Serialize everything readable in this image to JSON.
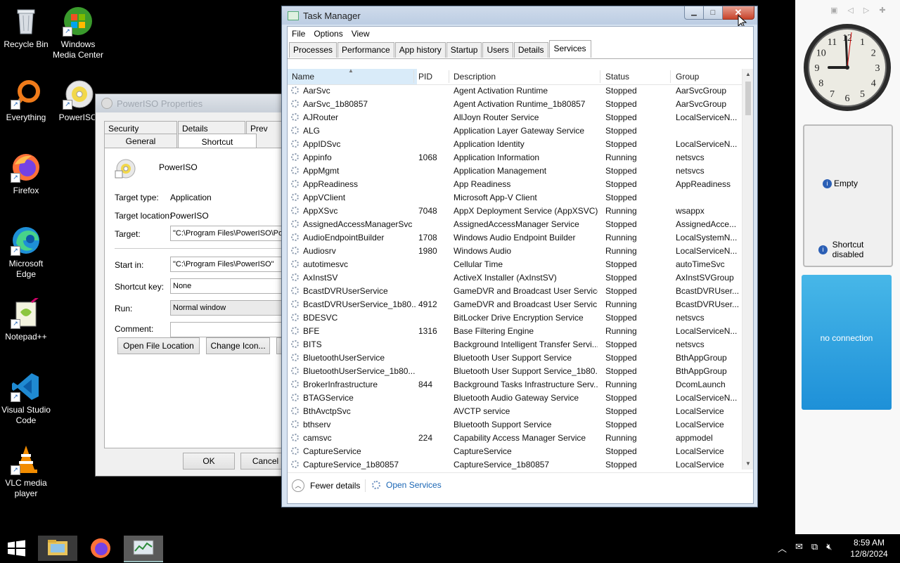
{
  "desktop": {
    "icons": [
      {
        "label": "Recycle Bin",
        "icon": "recycle-bin-icon"
      },
      {
        "label": "Windows Media Center",
        "icon": "media-center-icon"
      },
      {
        "label": "Everything",
        "icon": "everything-icon"
      },
      {
        "label": "PowerISO",
        "icon": "poweriso-icon"
      },
      {
        "label": "Firefox",
        "icon": "firefox-icon"
      },
      {
        "label": "Microsoft Edge",
        "icon": "edge-icon"
      },
      {
        "label": "Notepad++",
        "icon": "notepadpp-icon"
      },
      {
        "label": "Visual Studio Code",
        "icon": "vscode-icon"
      },
      {
        "label": "VLC media player",
        "icon": "vlc-icon"
      }
    ]
  },
  "properties": {
    "title": "PowerISO Properties",
    "tabs_top": [
      "Security",
      "Details",
      "Prev"
    ],
    "tabs_bottom": [
      "General",
      "Shortcut"
    ],
    "app_name": "PowerISO",
    "target_type_label": "Target type:",
    "target_type": "Application",
    "target_location_label": "Target location:",
    "target_location": "PowerISO",
    "target_label": "Target:",
    "target": "\"C:\\Program Files\\PowerISO\\PowerISO.exe\"",
    "start_in_label": "Start in:",
    "start_in": "\"C:\\Program Files\\PowerISO\"",
    "shortcut_key_label": "Shortcut key:",
    "shortcut_key": "None",
    "run_label": "Run:",
    "run": "Normal window",
    "comment_label": "Comment:",
    "comment": "",
    "open_location": "Open File Location",
    "change_icon": "Change Icon...",
    "ok": "OK",
    "cancel": "Cancel"
  },
  "taskmgr": {
    "title": "Task Manager",
    "menu": [
      "File",
      "Options",
      "View"
    ],
    "tabs": [
      "Processes",
      "Performance",
      "App history",
      "Startup",
      "Users",
      "Details",
      "Services"
    ],
    "active_tab": "Services",
    "columns": {
      "name": "Name",
      "pid": "PID",
      "description": "Description",
      "status": "Status",
      "group": "Group"
    },
    "rows": [
      {
        "name": "AarSvc",
        "pid": "",
        "desc": "Agent Activation Runtime",
        "status": "Stopped",
        "group": "AarSvcGroup"
      },
      {
        "name": "AarSvc_1b80857",
        "pid": "",
        "desc": "Agent Activation Runtime_1b80857",
        "status": "Stopped",
        "group": "AarSvcGroup"
      },
      {
        "name": "AJRouter",
        "pid": "",
        "desc": "AllJoyn Router Service",
        "status": "Stopped",
        "group": "LocalServiceN..."
      },
      {
        "name": "ALG",
        "pid": "",
        "desc": "Application Layer Gateway Service",
        "status": "Stopped",
        "group": ""
      },
      {
        "name": "AppIDSvc",
        "pid": "",
        "desc": "Application Identity",
        "status": "Stopped",
        "group": "LocalServiceN..."
      },
      {
        "name": "Appinfo",
        "pid": "1068",
        "desc": "Application Information",
        "status": "Running",
        "group": "netsvcs"
      },
      {
        "name": "AppMgmt",
        "pid": "",
        "desc": "Application Management",
        "status": "Stopped",
        "group": "netsvcs"
      },
      {
        "name": "AppReadiness",
        "pid": "",
        "desc": "App Readiness",
        "status": "Stopped",
        "group": "AppReadiness"
      },
      {
        "name": "AppVClient",
        "pid": "",
        "desc": "Microsoft App-V Client",
        "status": "Stopped",
        "group": ""
      },
      {
        "name": "AppXSvc",
        "pid": "7048",
        "desc": "AppX Deployment Service (AppXSVC)",
        "status": "Running",
        "group": "wsappx"
      },
      {
        "name": "AssignedAccessManagerSvc",
        "pid": "",
        "desc": "AssignedAccessManager Service",
        "status": "Stopped",
        "group": "AssignedAcce..."
      },
      {
        "name": "AudioEndpointBuilder",
        "pid": "1708",
        "desc": "Windows Audio Endpoint Builder",
        "status": "Running",
        "group": "LocalSystemN..."
      },
      {
        "name": "Audiosrv",
        "pid": "1980",
        "desc": "Windows Audio",
        "status": "Running",
        "group": "LocalServiceN..."
      },
      {
        "name": "autotimesvc",
        "pid": "",
        "desc": "Cellular Time",
        "status": "Stopped",
        "group": "autoTimeSvc"
      },
      {
        "name": "AxInstSV",
        "pid": "",
        "desc": "ActiveX Installer (AxInstSV)",
        "status": "Stopped",
        "group": "AxInstSVGroup"
      },
      {
        "name": "BcastDVRUserService",
        "pid": "",
        "desc": "GameDVR and Broadcast User Service",
        "status": "Stopped",
        "group": "BcastDVRUser..."
      },
      {
        "name": "BcastDVRUserService_1b80...",
        "pid": "4912",
        "desc": "GameDVR and Broadcast User Servic...",
        "status": "Running",
        "group": "BcastDVRUser..."
      },
      {
        "name": "BDESVC",
        "pid": "",
        "desc": "BitLocker Drive Encryption Service",
        "status": "Stopped",
        "group": "netsvcs"
      },
      {
        "name": "BFE",
        "pid": "1316",
        "desc": "Base Filtering Engine",
        "status": "Running",
        "group": "LocalServiceN..."
      },
      {
        "name": "BITS",
        "pid": "",
        "desc": "Background Intelligent Transfer Servi...",
        "status": "Stopped",
        "group": "netsvcs"
      },
      {
        "name": "BluetoothUserService",
        "pid": "",
        "desc": "Bluetooth User Support Service",
        "status": "Stopped",
        "group": "BthAppGroup"
      },
      {
        "name": "BluetoothUserService_1b80...",
        "pid": "",
        "desc": "Bluetooth User Support Service_1b80...",
        "status": "Stopped",
        "group": "BthAppGroup"
      },
      {
        "name": "BrokerInfrastructure",
        "pid": "844",
        "desc": "Background Tasks Infrastructure Serv...",
        "status": "Running",
        "group": "DcomLaunch"
      },
      {
        "name": "BTAGService",
        "pid": "",
        "desc": "Bluetooth Audio Gateway Service",
        "status": "Stopped",
        "group": "LocalServiceN..."
      },
      {
        "name": "BthAvctpSvc",
        "pid": "",
        "desc": "AVCTP service",
        "status": "Stopped",
        "group": "LocalService"
      },
      {
        "name": "bthserv",
        "pid": "",
        "desc": "Bluetooth Support Service",
        "status": "Stopped",
        "group": "LocalService"
      },
      {
        "name": "camsvc",
        "pid": "224",
        "desc": "Capability Access Manager Service",
        "status": "Running",
        "group": "appmodel"
      },
      {
        "name": "CaptureService",
        "pid": "",
        "desc": "CaptureService",
        "status": "Stopped",
        "group": "LocalService"
      },
      {
        "name": "CaptureService_1b80857",
        "pid": "",
        "desc": "CaptureService_1b80857",
        "status": "Stopped",
        "group": "LocalService"
      }
    ],
    "fewer_details": "Fewer details",
    "open_services": "Open Services"
  },
  "gadgets": {
    "clock": {
      "numerals": [
        "12",
        "1",
        "2",
        "3",
        "4",
        "5",
        "6",
        "7",
        "8",
        "9",
        "10",
        "11"
      ],
      "time": "8:59"
    },
    "slideshow": {
      "empty_text": "Empty",
      "shortcut_text": "Shortcut disabled"
    },
    "weather": {
      "text": "no connection"
    }
  },
  "taskbar": {
    "time": "8:59 AM",
    "date": "12/8/2024"
  },
  "colors": {
    "accent_blue": "#1e90d8",
    "link_blue": "#1a66b5"
  }
}
